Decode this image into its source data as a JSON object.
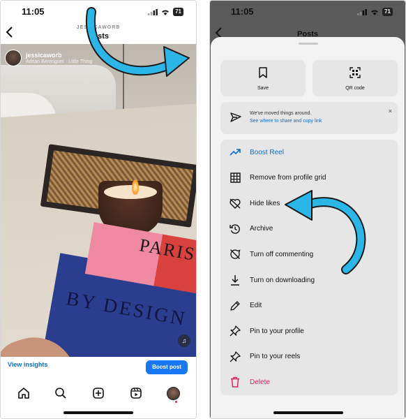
{
  "left": {
    "status": {
      "time": "11:05",
      "battery": "71"
    },
    "header": {
      "username_caps": "JESSICAWORB",
      "title": "Posts"
    },
    "post": {
      "username": "jessicaworb",
      "audio": "Adrian Berenguer · Little Thing",
      "book_title_top": "PARIS",
      "book_title_main": "BY DESIGN",
      "more": "···"
    },
    "actions": {
      "view_insights": "View insights",
      "boost_post": "Boost post"
    },
    "tabbar": [
      "home-icon",
      "search-icon",
      "create-icon",
      "reels-icon",
      "profile-avatar"
    ]
  },
  "right": {
    "status": {
      "time": "11:05",
      "battery": "71"
    },
    "header": {
      "title": "Posts"
    },
    "tiles": [
      {
        "label": "Save",
        "icon": "bookmark-icon"
      },
      {
        "label": "QR code",
        "icon": "qr-code-icon"
      }
    ],
    "notice": {
      "text": "We've moved things around.",
      "link": "See where to share and copy link",
      "close": "×"
    },
    "menu": [
      {
        "label": "Boost Reel",
        "icon": "trending-up-icon",
        "kind": "boost-reel"
      },
      {
        "label": "Remove from profile grid",
        "icon": "grid-icon",
        "kind": "normal"
      },
      {
        "label": "Hide likes",
        "icon": "heart-off-icon",
        "kind": "normal"
      },
      {
        "label": "Archive",
        "icon": "archive-icon",
        "kind": "normal"
      },
      {
        "label": "Turn off commenting",
        "icon": "comment-off-icon",
        "kind": "normal"
      },
      {
        "label": "Turn on downloading",
        "icon": "download-icon",
        "kind": "normal"
      },
      {
        "label": "Edit",
        "icon": "pencil-icon",
        "kind": "normal"
      },
      {
        "label": "Pin to your profile",
        "icon": "pin-icon",
        "kind": "normal"
      },
      {
        "label": "Pin to your reels",
        "icon": "pin-icon",
        "kind": "normal"
      },
      {
        "label": "Delete",
        "icon": "trash-icon",
        "kind": "delete"
      }
    ]
  },
  "colors": {
    "accent": "#1877f2",
    "link": "#0b6fcf",
    "danger": "#e0245e",
    "arrow": "#2bb6e8"
  }
}
